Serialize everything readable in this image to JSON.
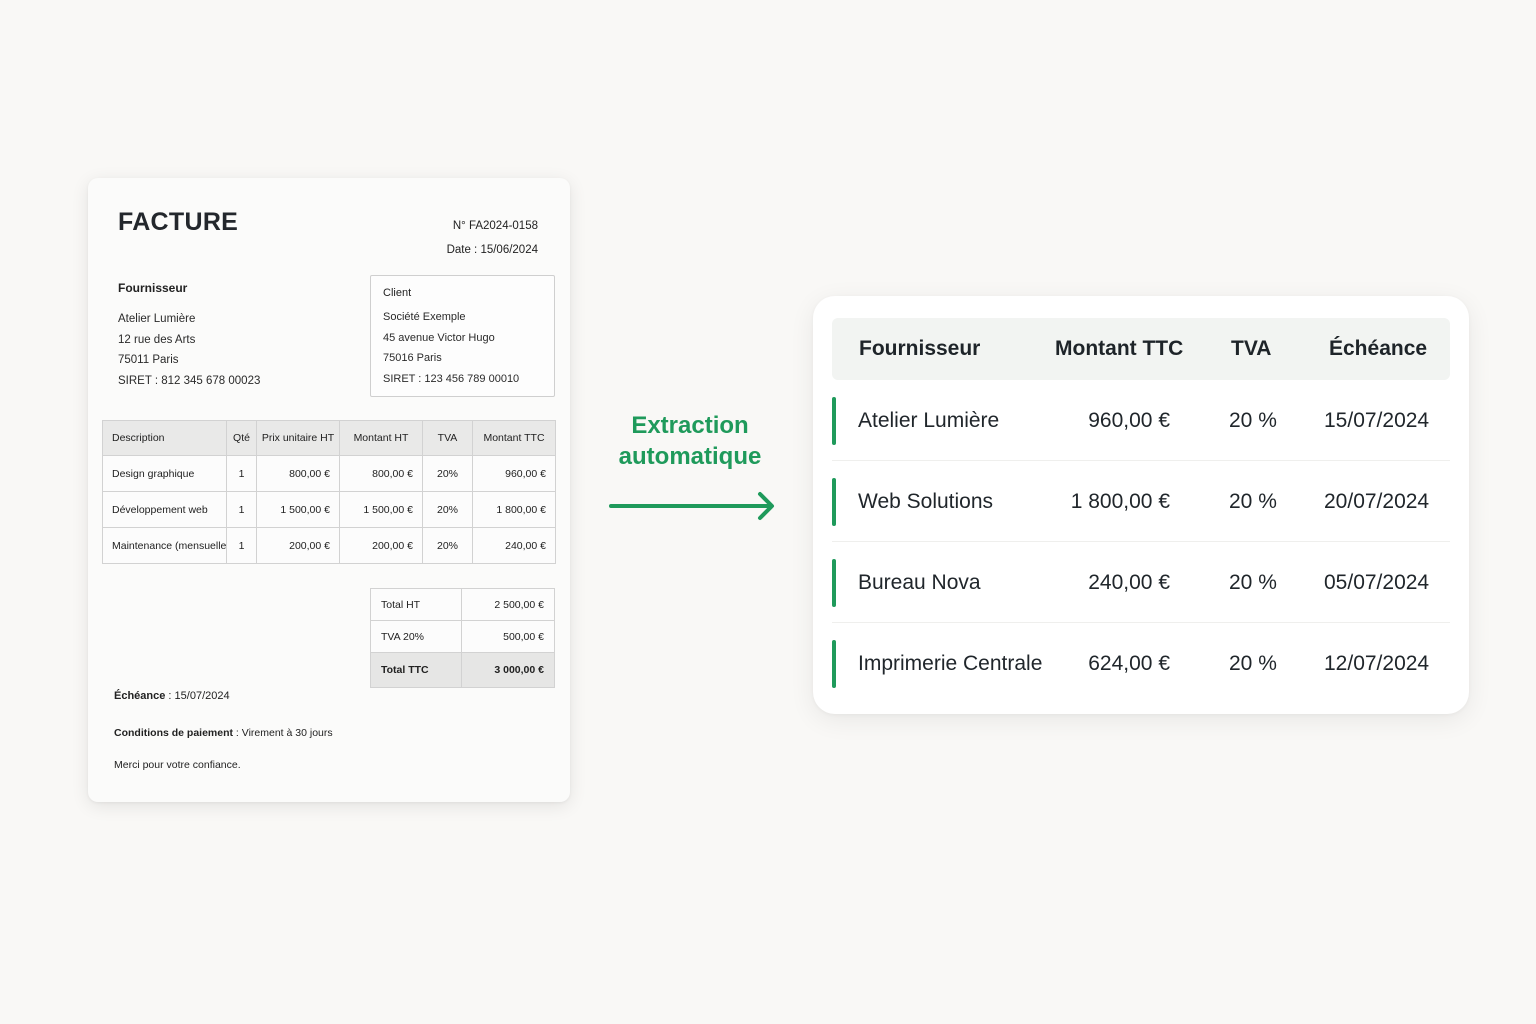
{
  "invoice": {
    "title": "FACTURE",
    "number": "N° FA2024-0158",
    "date": "Date : 15/06/2024",
    "supplier": {
      "label": "Fournisseur",
      "lines": [
        "Atelier Lumière",
        "12 rue des Arts",
        "75011 Paris",
        "SIRET : 812 345 678 00023"
      ]
    },
    "client": {
      "label": "Client",
      "lines": [
        "Société Exemple",
        "45 avenue Victor Hugo",
        "75016 Paris",
        "SIRET : 123 456 789 00010"
      ]
    },
    "items_headers": [
      "Description",
      "Qté",
      "Prix unitaire HT",
      "Montant HT",
      "TVA",
      "Montant TTC"
    ],
    "items": [
      [
        "Design graphique",
        "1",
        "800,00 €",
        "800,00 €",
        "20%",
        "960,00 €"
      ],
      [
        "Développement web",
        "1",
        "1 500,00 €",
        "1 500,00 €",
        "20%",
        "1 800,00 €"
      ],
      [
        "Maintenance (mensuelle)",
        "1",
        "200,00 €",
        "200,00 €",
        "20%",
        "240,00 €"
      ]
    ],
    "totals": [
      {
        "label": "Total HT",
        "value": "2 500,00 €"
      },
      {
        "label": "TVA 20%",
        "value": "500,00 €"
      },
      {
        "label": "Total TTC",
        "value": "3 000,00 €"
      }
    ],
    "due_label": "Échéance",
    "due_value": " : 15/07/2024",
    "payment_label": "Conditions de paiement",
    "payment_value": " : Virement à 30 jours",
    "thanks": "Merci pour votre confiance."
  },
  "arrow": {
    "label_line1": "Extraction",
    "label_line2": "automatique",
    "color": "#1f9a5b"
  },
  "extracted": {
    "headers": [
      "Fournisseur",
      "Montant TTC",
      "TVA",
      "Échéance"
    ],
    "accent_color": "#1f9a5b",
    "rows": [
      [
        "Atelier Lumière",
        "960,00 €",
        "20 %",
        "15/07/2024"
      ],
      [
        "Web Solutions",
        "1 800,00 €",
        "20 %",
        "20/07/2024"
      ],
      [
        "Bureau Nova",
        "240,00 €",
        "20 %",
        "05/07/2024"
      ],
      [
        "Imprimerie Centrale",
        "624,00 €",
        "20 %",
        "12/07/2024"
      ]
    ]
  }
}
